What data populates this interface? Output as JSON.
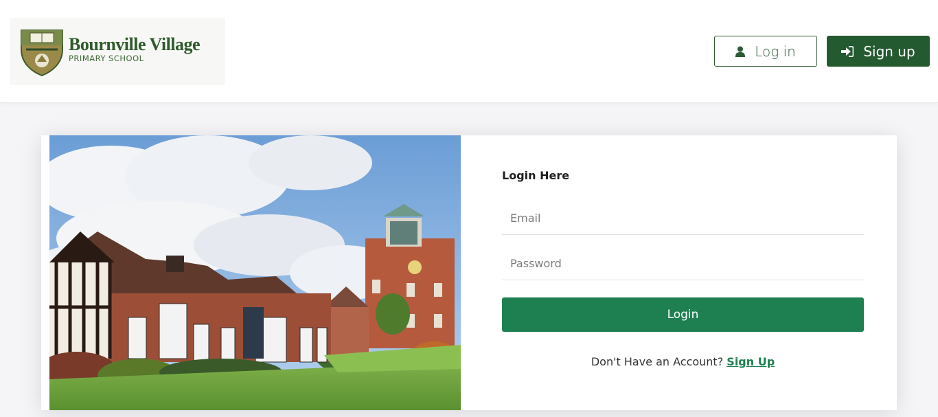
{
  "header": {
    "logo": {
      "name": "Bournville Village",
      "subtitle": "PRIMARY SCHOOL"
    },
    "login_button": {
      "label": "Log in",
      "icon": "user-icon"
    },
    "signup_button": {
      "label": "Sign up",
      "icon": "sign-in-icon"
    }
  },
  "login_form": {
    "title": "Login Here",
    "email": {
      "placeholder": "Email",
      "value": ""
    },
    "password": {
      "placeholder": "Password",
      "value": ""
    },
    "submit_label": "Login",
    "no_account_text": "Don't Have an Account?",
    "signup_link": "Sign Up"
  },
  "colors": {
    "brand_dark_green": "#245a30",
    "button_green": "#1e8050",
    "logo_green": "#2e5b2c"
  }
}
